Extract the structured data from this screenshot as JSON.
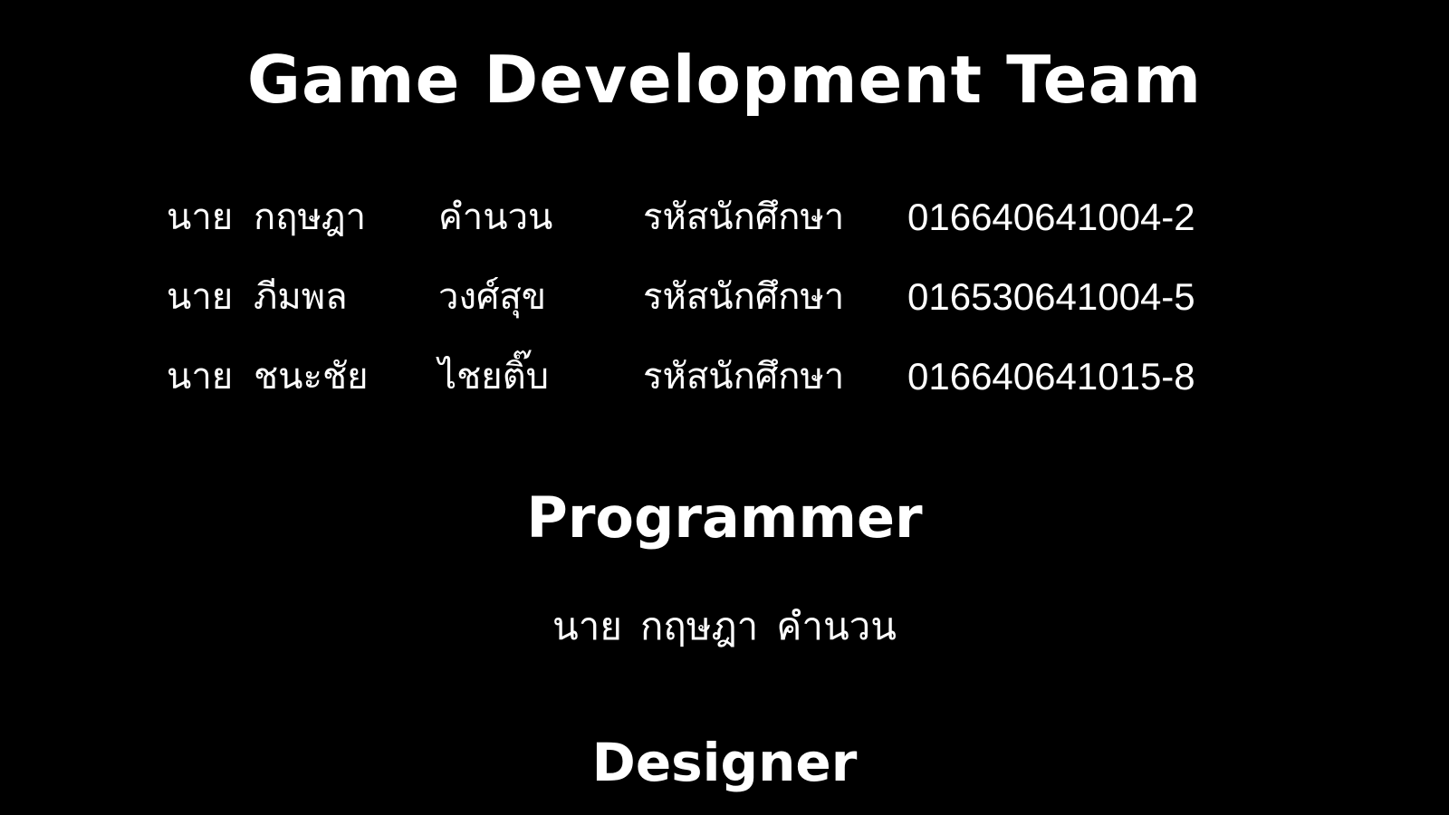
{
  "title": "Game Development Team",
  "members": [
    {
      "prefix": "นาย",
      "first_name": "กฤษฎา",
      "last_name": "คำนวน",
      "id_label": "รหัสนักศึกษา",
      "student_id": "016640641004-2"
    },
    {
      "prefix": "นาย",
      "first_name": "ภีมพล",
      "last_name": "วงศ์สุข",
      "id_label": "รหัสนักศึกษา",
      "student_id": "016530641004-5"
    },
    {
      "prefix": "นาย",
      "first_name": "ชนะชัย",
      "last_name": "ไชยติ๊บ",
      "id_label": "รหัสนักศึกษา",
      "student_id": "016640641015-8"
    }
  ],
  "sections": {
    "programmer": {
      "heading": "Programmer",
      "prefix": "นาย",
      "first_name": "กฤษฎา",
      "last_name": "คำนวน"
    },
    "designer": {
      "heading": "Designer"
    }
  },
  "colors": {
    "background": "#000000",
    "text": "#ffffff"
  }
}
